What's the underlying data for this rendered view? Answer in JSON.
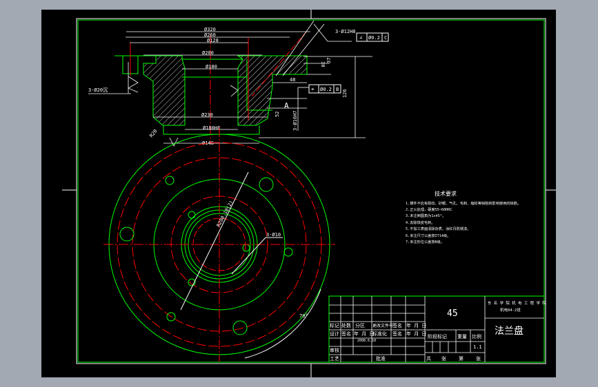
{
  "drawing": {
    "title": "法兰盘",
    "material": "45",
    "school": "东 名 学 院 机 电 工 程 学 院",
    "class": "机电04-2班",
    "scale": "1.1",
    "date": "2008.6.10"
  },
  "title_block": {
    "row_labels": [
      "标记",
      "处数",
      "分区",
      "更改文件号",
      "签名",
      "年 月 日"
    ],
    "row2_labels": [
      "设计",
      "签名",
      "年 月 日",
      "标准化",
      "签名",
      "年 月 日"
    ],
    "review": "审核",
    "process": "工艺",
    "approve": "批准",
    "stage_mark": "阶段标记",
    "weight": "重量",
    "ratio": "比例",
    "total": "共",
    "sheets": "张",
    "number": "第",
    "sheet": "张"
  },
  "tech_req": {
    "title": "技术要求",
    "items": [
      "1.铸件不应有裂纹、砂眼、气孔、毛刺、缩松等缺陷和影响使用的缺陷。",
      "2.正火处理，硬度55~60HRC",
      "3.未注倒圆角为1x45°。",
      "4.去除铁皮毛刺。",
      "5.不加工表面清除杂质，涂红丹防锈漆。",
      "6.未注尺寸公差按IT14级。",
      "7.未注形位公差按8级。"
    ]
  },
  "dimensions": {
    "d320": "Ø320",
    "d260": "Ø260",
    "d128": "Ø128",
    "d200": "Ø200",
    "d180": "Ø180",
    "d230": "Ø230",
    "d180h8": "Ø180H8",
    "d140": "Ø140",
    "holes_3x20": "3-Ø20沉",
    "holes_3x12": "3-Ø12H8",
    "holes_3x10": "3-Ø10",
    "holes_3x16": "3-Ø16H7",
    "pcd": "R280.10(2)",
    "d30": "30",
    "d37": "37",
    "d48": "48",
    "d126": "126",
    "d52": "52",
    "r20": "R20",
    "angle70": "70°",
    "tol1_sym": "∠",
    "tol1_val": "Ø0.2",
    "tol1_ref": "C",
    "tol2_sym": "⌖",
    "tol2_val": "Ø0.2",
    "tol2_ref": "B",
    "datum_a": "A",
    "ra": "Ra"
  },
  "colors": {
    "outline": "#00ff00",
    "center": "#ff0000",
    "dim": "#ffffff",
    "bg": "#000000"
  }
}
